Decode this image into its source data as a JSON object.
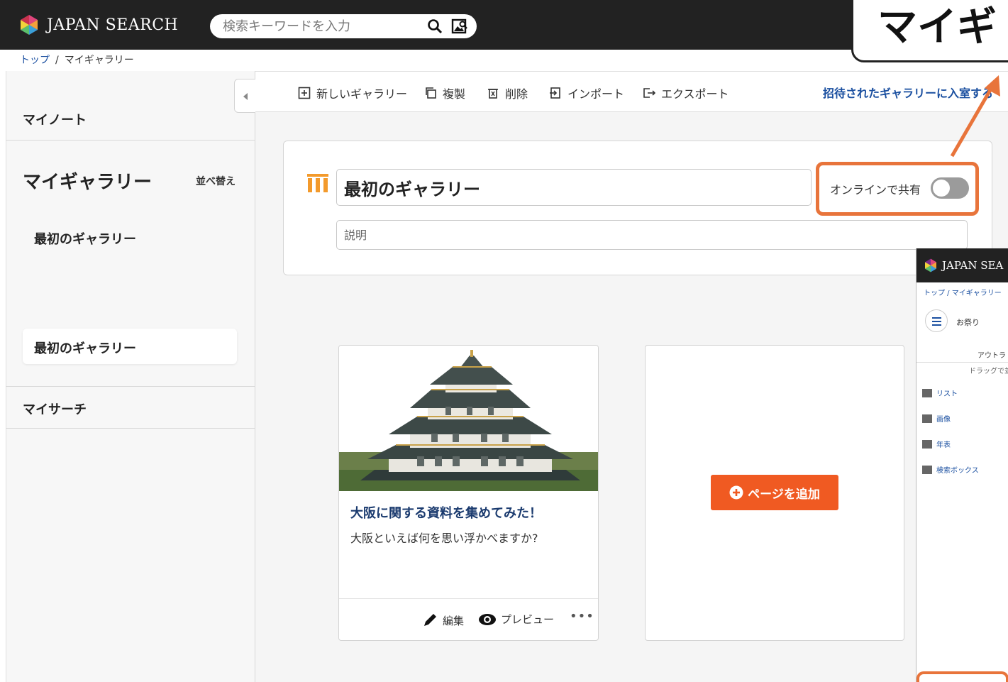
{
  "header": {
    "logo_text": "JAPAN SEARCH",
    "search_placeholder": "検索キーワードを入力"
  },
  "breadcrumb": {
    "home": "トップ",
    "separator": "/",
    "current": "マイギャラリー"
  },
  "sidebar": {
    "my_note": "マイノート",
    "my_gallery": "マイギャラリー",
    "sort_label": "並べ替え",
    "items": [
      "最初のギャラリー",
      "最初のギャラリー"
    ],
    "my_search": "マイサーチ"
  },
  "toolbar": {
    "new_gallery": "新しいギャラリー",
    "duplicate": "複製",
    "delete": "削除",
    "import": "インポート",
    "export": "エクスポート",
    "join_invited": "招待されたギャラリーに入室する"
  },
  "gallery": {
    "title": "最初のギャラリー",
    "share_label": "オンラインで共有",
    "share_enabled": false,
    "description_placeholder": "説明"
  },
  "page_card": {
    "title": "大阪に関する資料を集めてみた！",
    "description": "大阪といえば何を思い浮かべますか?",
    "edit_label": "編集",
    "preview_label": "プレビュー",
    "more_label": "•••"
  },
  "add_page": {
    "label": "ページを追加"
  },
  "callout": {
    "text": "マイギ"
  },
  "inset": {
    "logo_text": "JAPAN SEA",
    "breadcrumb": "トップ / マイギャラリー",
    "gallery_name": "お祭り",
    "outline": "アウトラ",
    "drag_hint": "ドラッグで並",
    "rows": [
      "リスト",
      "画像",
      "年表",
      "検索ボックス"
    ]
  },
  "colors": {
    "header_bg": "#222222",
    "accent_orange": "#e8743b",
    "add_button": "#f05a22",
    "link_blue": "#1a4fa0",
    "card_title": "#1a3a6e"
  }
}
